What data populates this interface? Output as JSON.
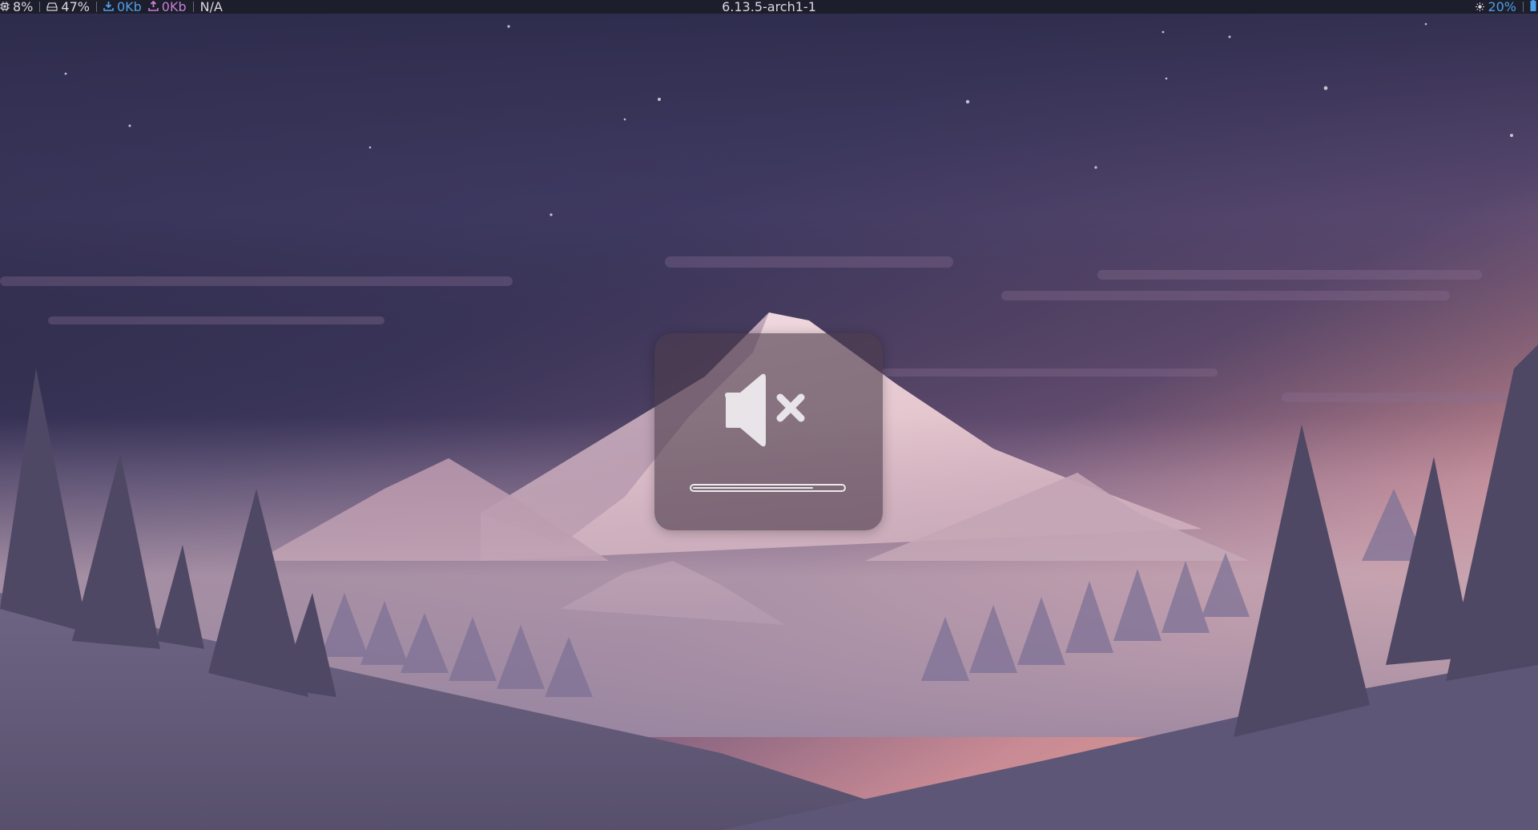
{
  "statusbar": {
    "cpu": {
      "icon": "cpu-chip-icon",
      "value": "8%"
    },
    "disk": {
      "icon": "hard-drive-icon",
      "value": "47%"
    },
    "net_down": {
      "icon": "download-icon",
      "value": "0Kb"
    },
    "net_up": {
      "icon": "upload-icon",
      "value": "0Kb"
    },
    "misc": {
      "value": "N/A"
    },
    "kernel": "6.13.5-arch1-1",
    "brightness": {
      "icon": "sun-icon",
      "value": "20%"
    },
    "battery": {
      "icon": "battery-icon"
    }
  },
  "osd": {
    "icon": "speaker-muted-icon",
    "muted": true,
    "volume_level": 0.8
  },
  "colors": {
    "bar_bg": "#1c1e2b",
    "download": "#4f9fe8",
    "upload": "#c77fd6",
    "brightness": "#4f9fe8"
  }
}
